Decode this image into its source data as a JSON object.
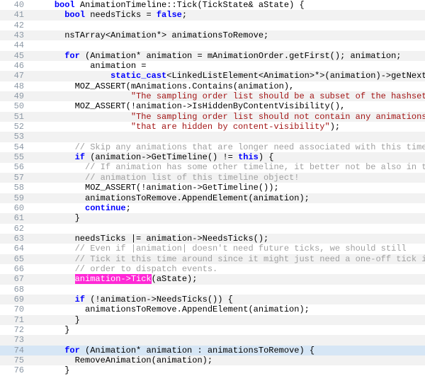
{
  "gutter_start": 40,
  "search_highlight": "animation->Tick",
  "lines": [
    {
      "n": 40,
      "alt": false,
      "hl": false,
      "segs": [
        [
          "    ",
          ""
        ],
        [
          "bool",
          "kw"
        ],
        [
          " AnimationTimeline::Tick(TickState& aState) {",
          ""
        ]
      ]
    },
    {
      "n": 41,
      "alt": true,
      "hl": false,
      "segs": [
        [
          "      ",
          ""
        ],
        [
          "bool",
          "kw"
        ],
        [
          " needsTicks = ",
          ""
        ],
        [
          "false",
          "kw"
        ],
        [
          ";",
          ""
        ]
      ]
    },
    {
      "n": 42,
      "alt": false,
      "hl": false,
      "segs": [
        [
          "",
          ""
        ]
      ]
    },
    {
      "n": 43,
      "alt": true,
      "hl": false,
      "segs": [
        [
          "      nsTArray<Animation*> animationsToRemove;",
          ""
        ]
      ]
    },
    {
      "n": 44,
      "alt": false,
      "hl": false,
      "segs": [
        [
          "",
          ""
        ]
      ]
    },
    {
      "n": 45,
      "alt": true,
      "hl": false,
      "segs": [
        [
          "      ",
          ""
        ],
        [
          "for",
          "kw"
        ],
        [
          " (Animation* animation = mAnimationOrder.getFirst(); animation;",
          ""
        ]
      ]
    },
    {
      "n": 46,
      "alt": false,
      "hl": false,
      "segs": [
        [
          "           animation =",
          ""
        ]
      ]
    },
    {
      "n": 47,
      "alt": true,
      "hl": false,
      "segs": [
        [
          "               ",
          ""
        ],
        [
          "static_cast",
          "kw"
        ],
        [
          "<LinkedListElement<Animation>*>(animation)->getNext()) {",
          ""
        ]
      ]
    },
    {
      "n": 48,
      "alt": false,
      "hl": false,
      "segs": [
        [
          "        MOZ_ASSERT(mAnimations.Contains(animation),",
          ""
        ]
      ]
    },
    {
      "n": 49,
      "alt": true,
      "hl": false,
      "segs": [
        [
          "                   ",
          ""
        ],
        [
          "\"The sampling order list should be a subset of the hashset\"",
          "str"
        ],
        [
          ");",
          ""
        ]
      ]
    },
    {
      "n": 50,
      "alt": false,
      "hl": false,
      "segs": [
        [
          "        MOZ_ASSERT(!animation->IsHiddenByContentVisibility(),",
          ""
        ]
      ]
    },
    {
      "n": 51,
      "alt": true,
      "hl": false,
      "segs": [
        [
          "                   ",
          ""
        ],
        [
          "\"The sampling order list should not contain any animations \"",
          "str"
        ]
      ]
    },
    {
      "n": 52,
      "alt": false,
      "hl": false,
      "segs": [
        [
          "                   ",
          ""
        ],
        [
          "\"that are hidden by content-visibility\"",
          "str"
        ],
        [
          ");",
          ""
        ]
      ]
    },
    {
      "n": 53,
      "alt": true,
      "hl": false,
      "segs": [
        [
          "",
          ""
        ]
      ]
    },
    {
      "n": 54,
      "alt": false,
      "hl": false,
      "segs": [
        [
          "        ",
          ""
        ],
        [
          "// Skip any animations that are longer need associated with this timeline.",
          "comment"
        ]
      ]
    },
    {
      "n": 55,
      "alt": true,
      "hl": false,
      "segs": [
        [
          "        ",
          ""
        ],
        [
          "if",
          "kw"
        ],
        [
          " (animation->GetTimeline() != ",
          ""
        ],
        [
          "this",
          "kw"
        ],
        [
          ") {",
          ""
        ]
      ]
    },
    {
      "n": 56,
      "alt": false,
      "hl": false,
      "segs": [
        [
          "          ",
          ""
        ],
        [
          "// If animation has some other timeline, it better not be also in the",
          "comment"
        ]
      ]
    },
    {
      "n": 57,
      "alt": true,
      "hl": false,
      "segs": [
        [
          "          ",
          ""
        ],
        [
          "// animation list of this timeline object!",
          "comment"
        ]
      ]
    },
    {
      "n": 58,
      "alt": false,
      "hl": false,
      "segs": [
        [
          "          MOZ_ASSERT(!animation->GetTimeline());",
          ""
        ]
      ]
    },
    {
      "n": 59,
      "alt": true,
      "hl": false,
      "segs": [
        [
          "          animationsToRemove.AppendElement(animation);",
          ""
        ]
      ]
    },
    {
      "n": 60,
      "alt": false,
      "hl": false,
      "segs": [
        [
          "          ",
          ""
        ],
        [
          "continue",
          "kw"
        ],
        [
          ";",
          ""
        ]
      ]
    },
    {
      "n": 61,
      "alt": true,
      "hl": false,
      "segs": [
        [
          "        }",
          ""
        ]
      ]
    },
    {
      "n": 62,
      "alt": false,
      "hl": false,
      "segs": [
        [
          "",
          ""
        ]
      ]
    },
    {
      "n": 63,
      "alt": true,
      "hl": false,
      "segs": [
        [
          "        needsTicks |= animation->NeedsTicks();",
          ""
        ]
      ]
    },
    {
      "n": 64,
      "alt": false,
      "hl": false,
      "segs": [
        [
          "        ",
          ""
        ],
        [
          "// Even if |animation| doesn't need future ticks, we should still",
          "comment"
        ]
      ]
    },
    {
      "n": 65,
      "alt": true,
      "hl": false,
      "segs": [
        [
          "        ",
          ""
        ],
        [
          "// Tick it this time around since it might just need a one-off tick in",
          "comment"
        ]
      ]
    },
    {
      "n": 66,
      "alt": false,
      "hl": false,
      "segs": [
        [
          "        ",
          ""
        ],
        [
          "// order to dispatch events.",
          "comment"
        ]
      ]
    },
    {
      "n": 67,
      "alt": true,
      "hl": false,
      "segs": [
        [
          "        ",
          ""
        ],
        [
          "animation->Tick",
          "hl-search"
        ],
        [
          "(aState);",
          ""
        ]
      ]
    },
    {
      "n": 68,
      "alt": false,
      "hl": false,
      "segs": [
        [
          "",
          ""
        ]
      ]
    },
    {
      "n": 69,
      "alt": true,
      "hl": false,
      "segs": [
        [
          "        ",
          ""
        ],
        [
          "if",
          "kw"
        ],
        [
          " (!animation->NeedsTicks()) {",
          ""
        ]
      ]
    },
    {
      "n": 70,
      "alt": false,
      "hl": false,
      "segs": [
        [
          "          animationsToRemove.AppendElement(animation);",
          ""
        ]
      ]
    },
    {
      "n": 71,
      "alt": true,
      "hl": false,
      "segs": [
        [
          "        }",
          ""
        ]
      ]
    },
    {
      "n": 72,
      "alt": false,
      "hl": false,
      "segs": [
        [
          "      }",
          ""
        ]
      ]
    },
    {
      "n": 73,
      "alt": true,
      "hl": false,
      "segs": [
        [
          "",
          ""
        ]
      ]
    },
    {
      "n": 74,
      "alt": false,
      "hl": true,
      "segs": [
        [
          "      ",
          ""
        ],
        [
          "for",
          "kw"
        ],
        [
          " (Animation* animation : animationsToRemove) {",
          ""
        ]
      ]
    },
    {
      "n": 75,
      "alt": true,
      "hl": false,
      "segs": [
        [
          "        RemoveAnimation(animation);",
          ""
        ]
      ]
    },
    {
      "n": 76,
      "alt": false,
      "hl": false,
      "segs": [
        [
          "      }",
          ""
        ]
      ]
    }
  ]
}
